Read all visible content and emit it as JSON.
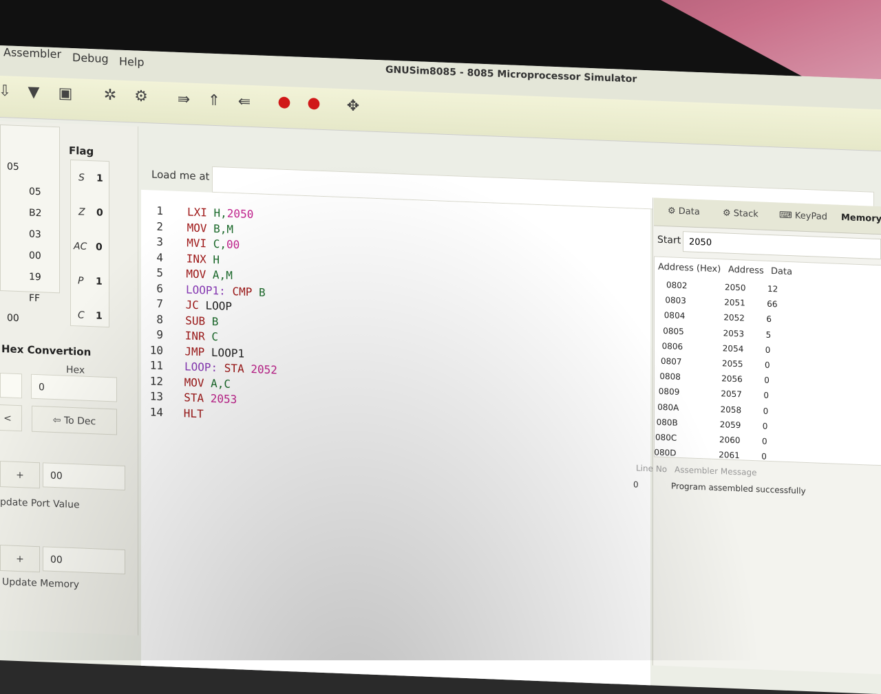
{
  "menu": {
    "items": [
      "Assembler",
      "Debug",
      "Help"
    ]
  },
  "window": {
    "title": "GNUSim8085 - 8085 Microprocessor Simulator"
  },
  "toolbar": {
    "icons": [
      "open-file-icon",
      "save-icon",
      "print-icon",
      "assemble-icon",
      "execute-icon",
      "step-in-icon",
      "step-over-icon",
      "step-out-icon",
      "breakpoint-icon",
      "stop-icon",
      "move-icon"
    ],
    "accent_red": "#d01818"
  },
  "registers": {
    "top_value": "05",
    "values": [
      "05",
      "B2",
      "03",
      "00",
      "19",
      "FF"
    ],
    "bottom_value": "00"
  },
  "flags": {
    "title": "Flag",
    "items": [
      {
        "name": "S",
        "value": "1"
      },
      {
        "name": "Z",
        "value": "0"
      },
      {
        "name": "AC",
        "value": "0"
      },
      {
        "name": "P",
        "value": "1"
      },
      {
        "name": "C",
        "value": "1"
      }
    ]
  },
  "hex_convertion": {
    "title": "Hex Convertion",
    "hex_label": "Hex",
    "hex_value": "0",
    "left_button_fragment": "<",
    "to_dec_label": "To Dec"
  },
  "port": {
    "plus_label": "+",
    "value": "00",
    "update_label": "pdate Port Value"
  },
  "memory_update": {
    "plus_label": "+",
    "value": "00",
    "update_label": "Update Memory"
  },
  "editor": {
    "load_label": "Load me at",
    "load_value": "",
    "lines": [
      {
        "n": "1",
        "tokens": [
          [
            "kw",
            "LXI "
          ],
          [
            "reg",
            "H,"
          ],
          [
            "num",
            "2050"
          ]
        ]
      },
      {
        "n": "2",
        "tokens": [
          [
            "kw",
            "MOV "
          ],
          [
            "reg",
            "B,M"
          ]
        ]
      },
      {
        "n": "3",
        "tokens": [
          [
            "kw",
            "MVI "
          ],
          [
            "reg",
            "C,"
          ],
          [
            "num",
            "00"
          ]
        ]
      },
      {
        "n": "4",
        "tokens": [
          [
            "kw",
            "INX "
          ],
          [
            "reg",
            "H"
          ]
        ]
      },
      {
        "n": "5",
        "tokens": [
          [
            "kw",
            "MOV "
          ],
          [
            "reg",
            "A,M"
          ]
        ]
      },
      {
        "n": "6",
        "tokens": [
          [
            "lbl",
            "LOOP1: "
          ],
          [
            "kw",
            "CMP "
          ],
          [
            "reg",
            "B"
          ]
        ]
      },
      {
        "n": "7",
        "tokens": [
          [
            "kw",
            "JC "
          ],
          [
            "txt",
            "LOOP"
          ]
        ]
      },
      {
        "n": "8",
        "tokens": [
          [
            "kw",
            "SUB "
          ],
          [
            "reg",
            "B"
          ]
        ]
      },
      {
        "n": "9",
        "tokens": [
          [
            "kw",
            "INR "
          ],
          [
            "reg",
            "C"
          ]
        ]
      },
      {
        "n": "10",
        "tokens": [
          [
            "kw",
            "JMP "
          ],
          [
            "txt",
            "LOOP1"
          ]
        ]
      },
      {
        "n": "11",
        "tokens": [
          [
            "lbl",
            "LOOP: "
          ],
          [
            "kw",
            "STA "
          ],
          [
            "num",
            "2052"
          ]
        ]
      },
      {
        "n": "12",
        "tokens": [
          [
            "kw",
            "MOV "
          ],
          [
            "reg",
            "A,C"
          ]
        ]
      },
      {
        "n": "13",
        "tokens": [
          [
            "kw",
            "STA "
          ],
          [
            "num",
            "2053"
          ]
        ]
      },
      {
        "n": "14",
        "tokens": [
          [
            "kw",
            "HLT"
          ]
        ]
      }
    ]
  },
  "right_panel": {
    "tabs": [
      {
        "label": "Data",
        "icon": "data-icon"
      },
      {
        "label": "Stack",
        "icon": "stack-icon"
      },
      {
        "label": "KeyPad",
        "icon": "keypad-icon"
      },
      {
        "label": "Memory",
        "active": true
      }
    ],
    "start_label": "Start",
    "start_value": "2050",
    "memory_headers": [
      "Address (Hex)",
      "Address",
      "Data"
    ],
    "memory_rows": [
      [
        "0802",
        "2050",
        "12"
      ],
      [
        "0803",
        "2051",
        "66"
      ],
      [
        "0804",
        "2052",
        "6"
      ],
      [
        "0805",
        "2053",
        "5"
      ],
      [
        "0806",
        "2054",
        "0"
      ],
      [
        "0807",
        "2055",
        "0"
      ],
      [
        "0808",
        "2056",
        "0"
      ],
      [
        "0809",
        "2057",
        "0"
      ],
      [
        "080A",
        "2058",
        "0"
      ],
      [
        "080B",
        "2059",
        "0"
      ],
      [
        "080C",
        "2060",
        "0"
      ],
      [
        "080D",
        "2061",
        "0"
      ]
    ],
    "message_headers": [
      "Line No",
      "Assembler Message"
    ],
    "message_row": [
      "0",
      "Program assembled successfully"
    ]
  }
}
